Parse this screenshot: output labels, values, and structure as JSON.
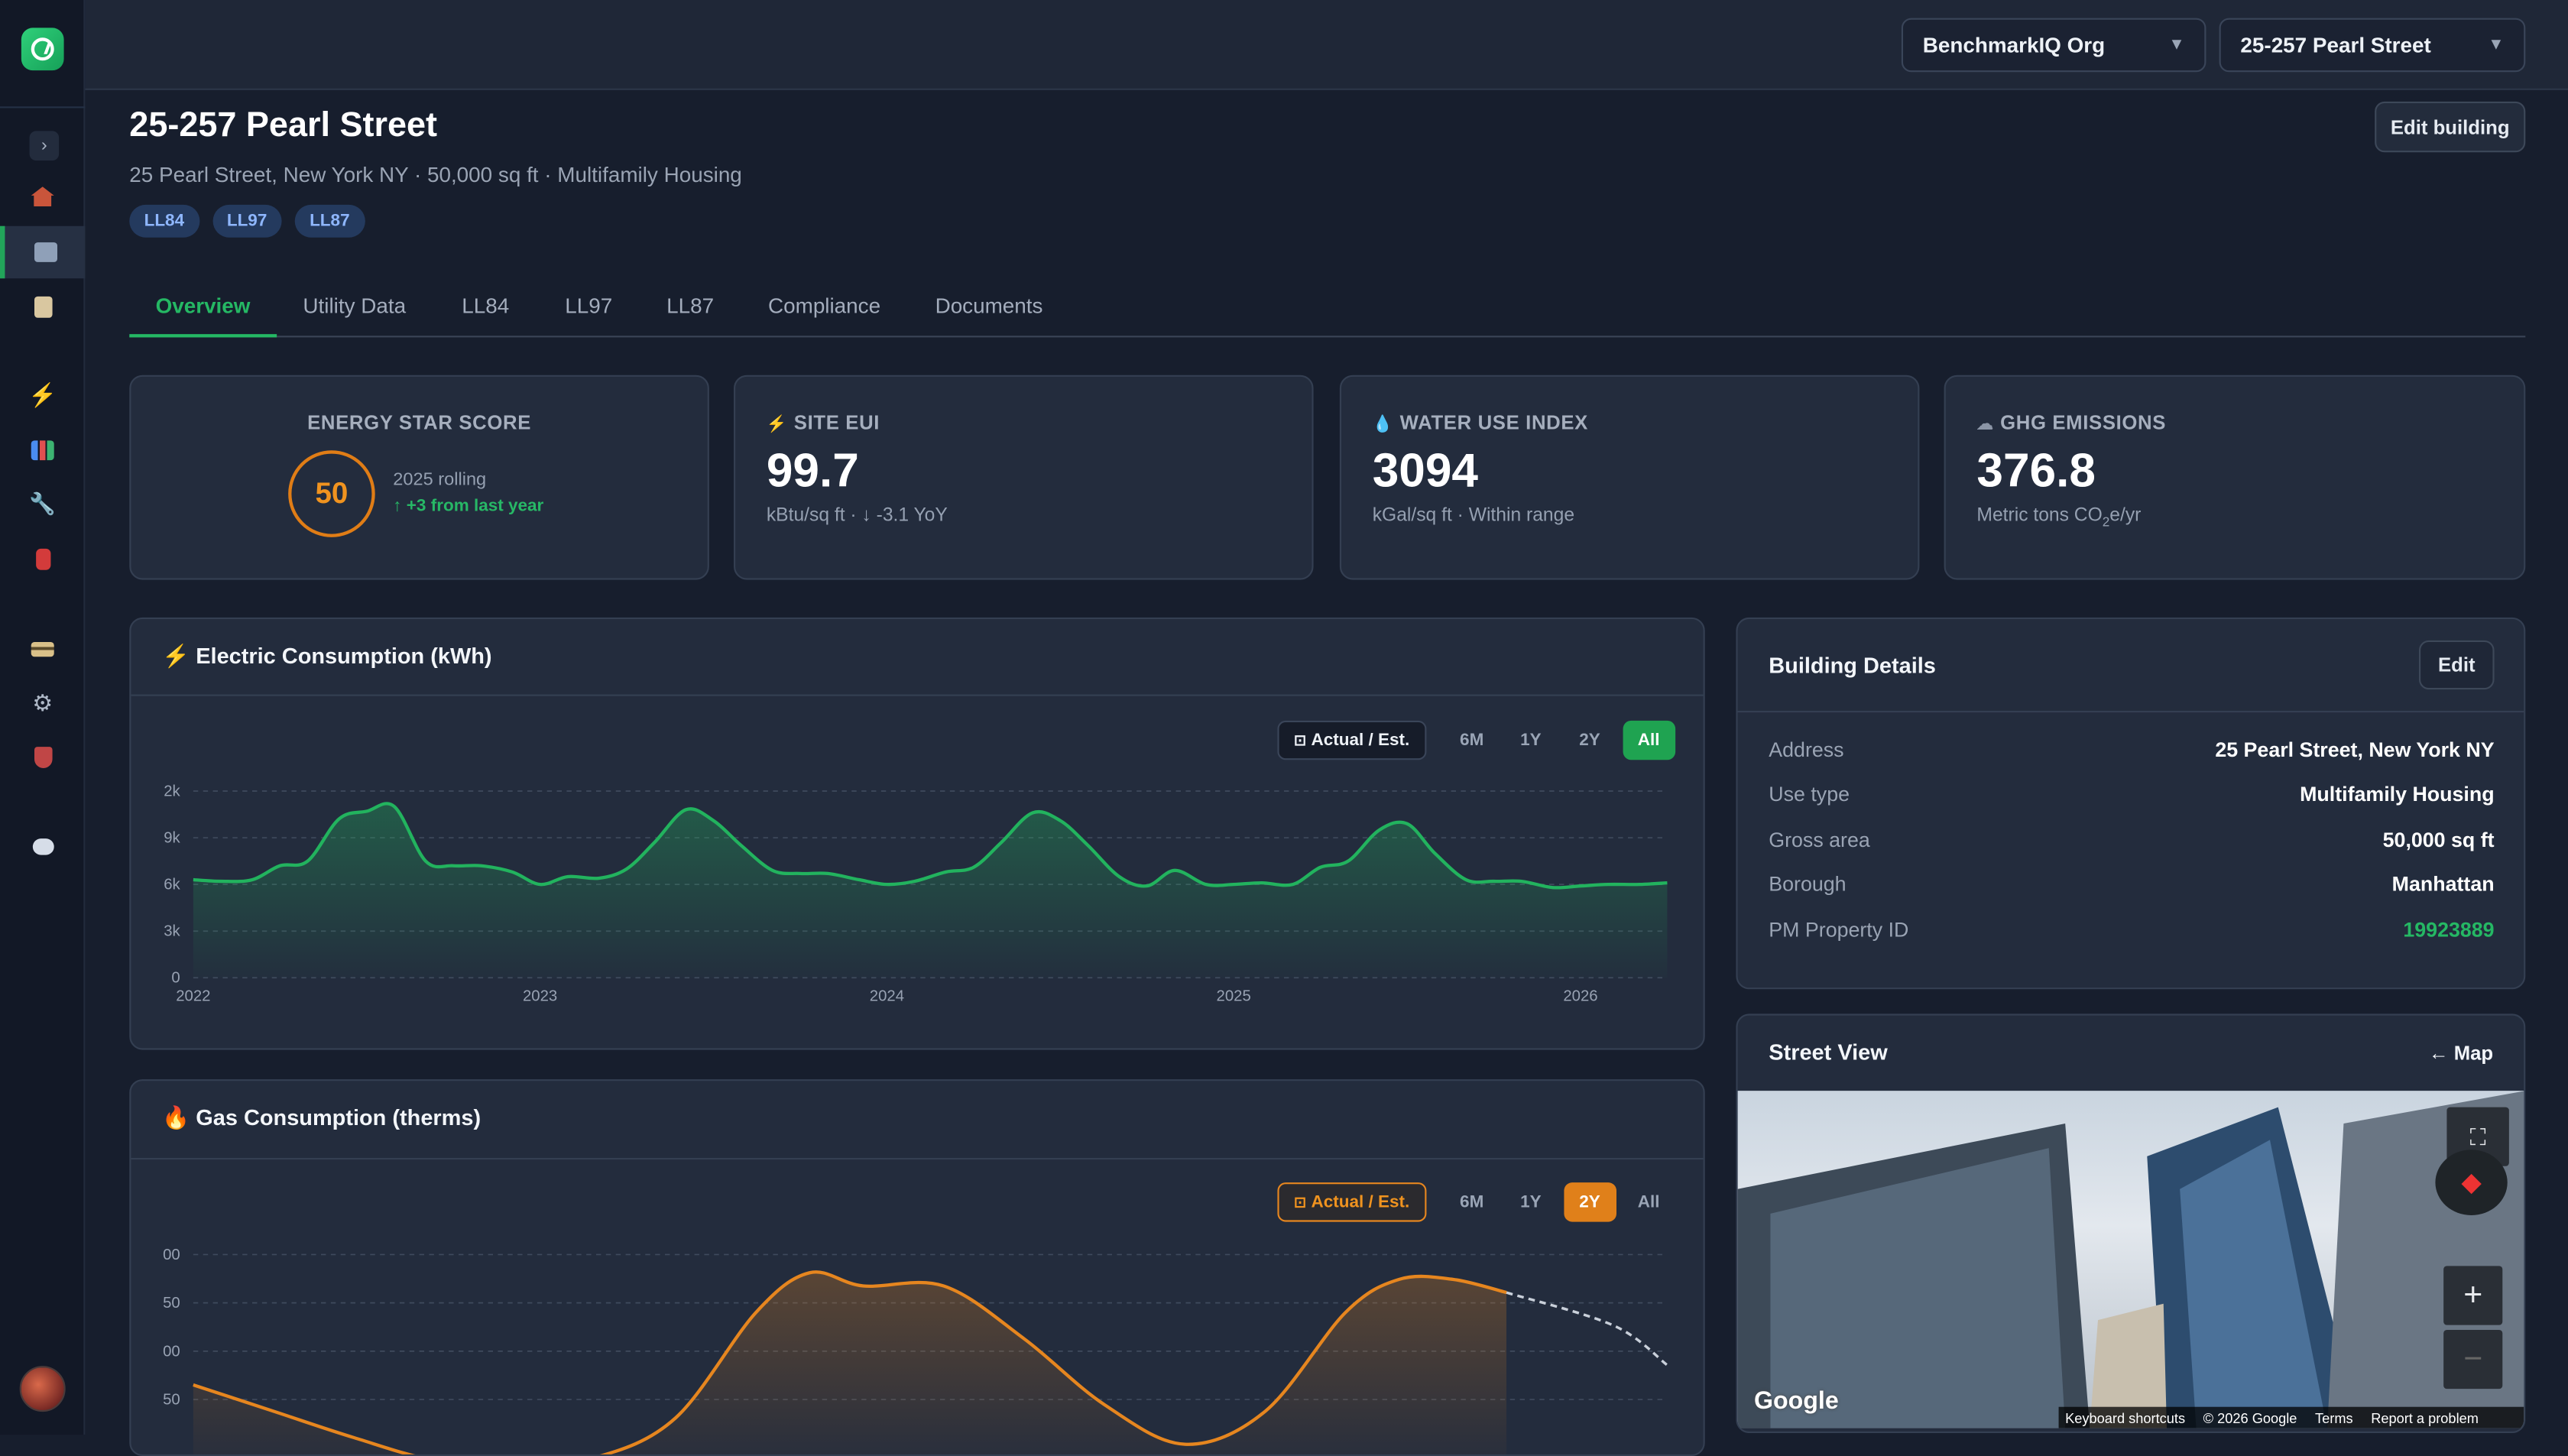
{
  "topbar": {
    "org_select": "BenchmarkIQ Org",
    "building_select": "25-257 Pearl Street"
  },
  "sidebar": {
    "items": [
      {
        "icon": "home-icon"
      },
      {
        "icon": "building-icon",
        "active": true
      },
      {
        "icon": "clipboard-icon"
      },
      {
        "icon": "lightning-icon"
      },
      {
        "icon": "bar-chart-icon"
      },
      {
        "icon": "wrench-icon"
      },
      {
        "icon": "fire-extinguisher-icon"
      },
      {
        "icon": "credit-card-icon"
      },
      {
        "icon": "gear-icon"
      },
      {
        "icon": "shield-icon"
      },
      {
        "icon": "chat-icon"
      }
    ]
  },
  "header": {
    "title": "25-257 Pearl Street",
    "subtitle": "25 Pearl Street, New York NY · 50,000 sq ft · Multifamily Housing",
    "tags": [
      "LL84",
      "LL97",
      "LL87"
    ],
    "edit_label": "Edit building"
  },
  "tabs": [
    "Overview",
    "Utility Data",
    "LL84",
    "LL97",
    "LL87",
    "Compliance",
    "Documents"
  ],
  "active_tab": "Overview",
  "metrics": {
    "energy_star": {
      "label": "ENERGY STAR SCORE",
      "value": "50",
      "period": "2025 rolling",
      "delta": "+3 from last year"
    },
    "site_eui": {
      "label": "SITE EUI",
      "value": "99.7",
      "sub": "kBtu/sq ft · ↓ -3.1 YoY"
    },
    "water": {
      "label": "WATER USE INDEX",
      "value": "3094",
      "sub": "kGal/sq ft · Within range"
    },
    "ghg": {
      "label": "GHG EMISSIONS",
      "value": "376.8",
      "sub_pre": "Metric tons CO",
      "sub_sub": "2",
      "sub_post": "e/yr"
    }
  },
  "electric": {
    "title": "Electric Consumption (kWh)",
    "toggle_label": "Actual / Est.",
    "ranges": [
      "6M",
      "1Y",
      "2Y",
      "All"
    ],
    "active_range": "All",
    "color": "#22b35e"
  },
  "gas": {
    "title": "Gas Consumption (therms)",
    "toggle_label": "Actual / Est.",
    "ranges": [
      "6M",
      "1Y",
      "2Y",
      "All"
    ],
    "active_range": "2Y",
    "color": "#e6861f"
  },
  "chart_data": [
    {
      "type": "area",
      "title": "Electric Consumption (kWh)",
      "y_tick_labels": [
        "0",
        "3k",
        "6k",
        "9k",
        "2k"
      ],
      "ylim": [
        0,
        12000
      ],
      "x_tick_labels": [
        "2022",
        "2023",
        "2024",
        "2025",
        "2026"
      ],
      "xlim": [
        2022.0,
        2026.25
      ],
      "grid": true,
      "series": [
        {
          "values": [
            [
              2022.0,
              6300
            ],
            [
              2022.08,
              6200
            ],
            [
              2022.17,
              6300
            ],
            [
              2022.25,
              7200
            ],
            [
              2022.33,
              7500
            ],
            [
              2022.42,
              10200
            ],
            [
              2022.5,
              10700
            ],
            [
              2022.58,
              11000
            ],
            [
              2022.67,
              7500
            ],
            [
              2022.75,
              7200
            ],
            [
              2022.83,
              7200
            ],
            [
              2022.92,
              6800
            ],
            [
              2023.0,
              6000
            ],
            [
              2023.08,
              6500
            ],
            [
              2023.17,
              6400
            ],
            [
              2023.25,
              7000
            ],
            [
              2023.33,
              8700
            ],
            [
              2023.42,
              10800
            ],
            [
              2023.5,
              10100
            ],
            [
              2023.58,
              8500
            ],
            [
              2023.67,
              6900
            ],
            [
              2023.75,
              6700
            ],
            [
              2023.83,
              6700
            ],
            [
              2023.92,
              6300
            ],
            [
              2024.0,
              6000
            ],
            [
              2024.08,
              6200
            ],
            [
              2024.17,
              6800
            ],
            [
              2024.25,
              7100
            ],
            [
              2024.33,
              8700
            ],
            [
              2024.42,
              10600
            ],
            [
              2024.5,
              10100
            ],
            [
              2024.58,
              8500
            ],
            [
              2024.67,
              6500
            ],
            [
              2024.75,
              5900
            ],
            [
              2024.83,
              6900
            ],
            [
              2024.92,
              6000
            ],
            [
              2025.0,
              6000
            ],
            [
              2025.08,
              6100
            ],
            [
              2025.17,
              6000
            ],
            [
              2025.25,
              7100
            ],
            [
              2025.33,
              7500
            ],
            [
              2025.42,
              9500
            ],
            [
              2025.5,
              9900
            ],
            [
              2025.58,
              8000
            ],
            [
              2025.67,
              6300
            ],
            [
              2025.75,
              6200
            ],
            [
              2025.83,
              6200
            ],
            [
              2025.92,
              5800
            ],
            [
              2026.0,
              5900
            ],
            [
              2026.08,
              6000
            ],
            [
              2026.17,
              6000
            ],
            [
              2026.25,
              6100
            ]
          ]
        }
      ]
    },
    {
      "type": "area",
      "title": "Gas Consumption (therms)",
      "y_tick_labels": [
        "50",
        "00",
        "50",
        "00"
      ],
      "x_range_shown": "2Y",
      "grid": true,
      "series": [
        {
          "values": [
            [
              0,
              0.75
            ],
            [
              0.06,
              0.55
            ],
            [
              0.12,
              0.35
            ],
            [
              0.18,
              0.18
            ],
            [
              0.24,
              0.15
            ],
            [
              0.3,
              0.2
            ],
            [
              0.36,
              0.5
            ],
            [
              0.42,
              1.3
            ],
            [
              0.46,
              1.6
            ],
            [
              0.5,
              1.5
            ],
            [
              0.56,
              1.5
            ],
            [
              0.62,
              1.1
            ],
            [
              0.68,
              0.6
            ],
            [
              0.74,
              0.3
            ],
            [
              0.8,
              0.55
            ],
            [
              0.86,
              1.3
            ],
            [
              0.9,
              1.55
            ],
            [
              0.94,
              1.55
            ],
            [
              0.98,
              1.45
            ]
          ]
        },
        {
          "estimated": true,
          "values": [
            [
              0.98,
              1.45
            ],
            [
              1.06,
              1.2
            ],
            [
              1.1,
              0.9
            ]
          ]
        }
      ]
    }
  ],
  "building_details": {
    "title": "Building Details",
    "edit_label": "Edit",
    "rows": [
      {
        "label": "Address",
        "value": "25 Pearl Street, New York NY"
      },
      {
        "label": "Use type",
        "value": "Multifamily Housing"
      },
      {
        "label": "Gross area",
        "value": "50,000 sq ft"
      },
      {
        "label": "Borough",
        "value": "Manhattan"
      },
      {
        "label": "PM Property ID",
        "value": "19923889"
      }
    ]
  },
  "street_view": {
    "title": "Street View",
    "map_link": "← Map",
    "logo": "Google",
    "footer": [
      "Keyboard shortcuts",
      "© 2026 Google",
      "Terms",
      "Report a problem"
    ]
  }
}
